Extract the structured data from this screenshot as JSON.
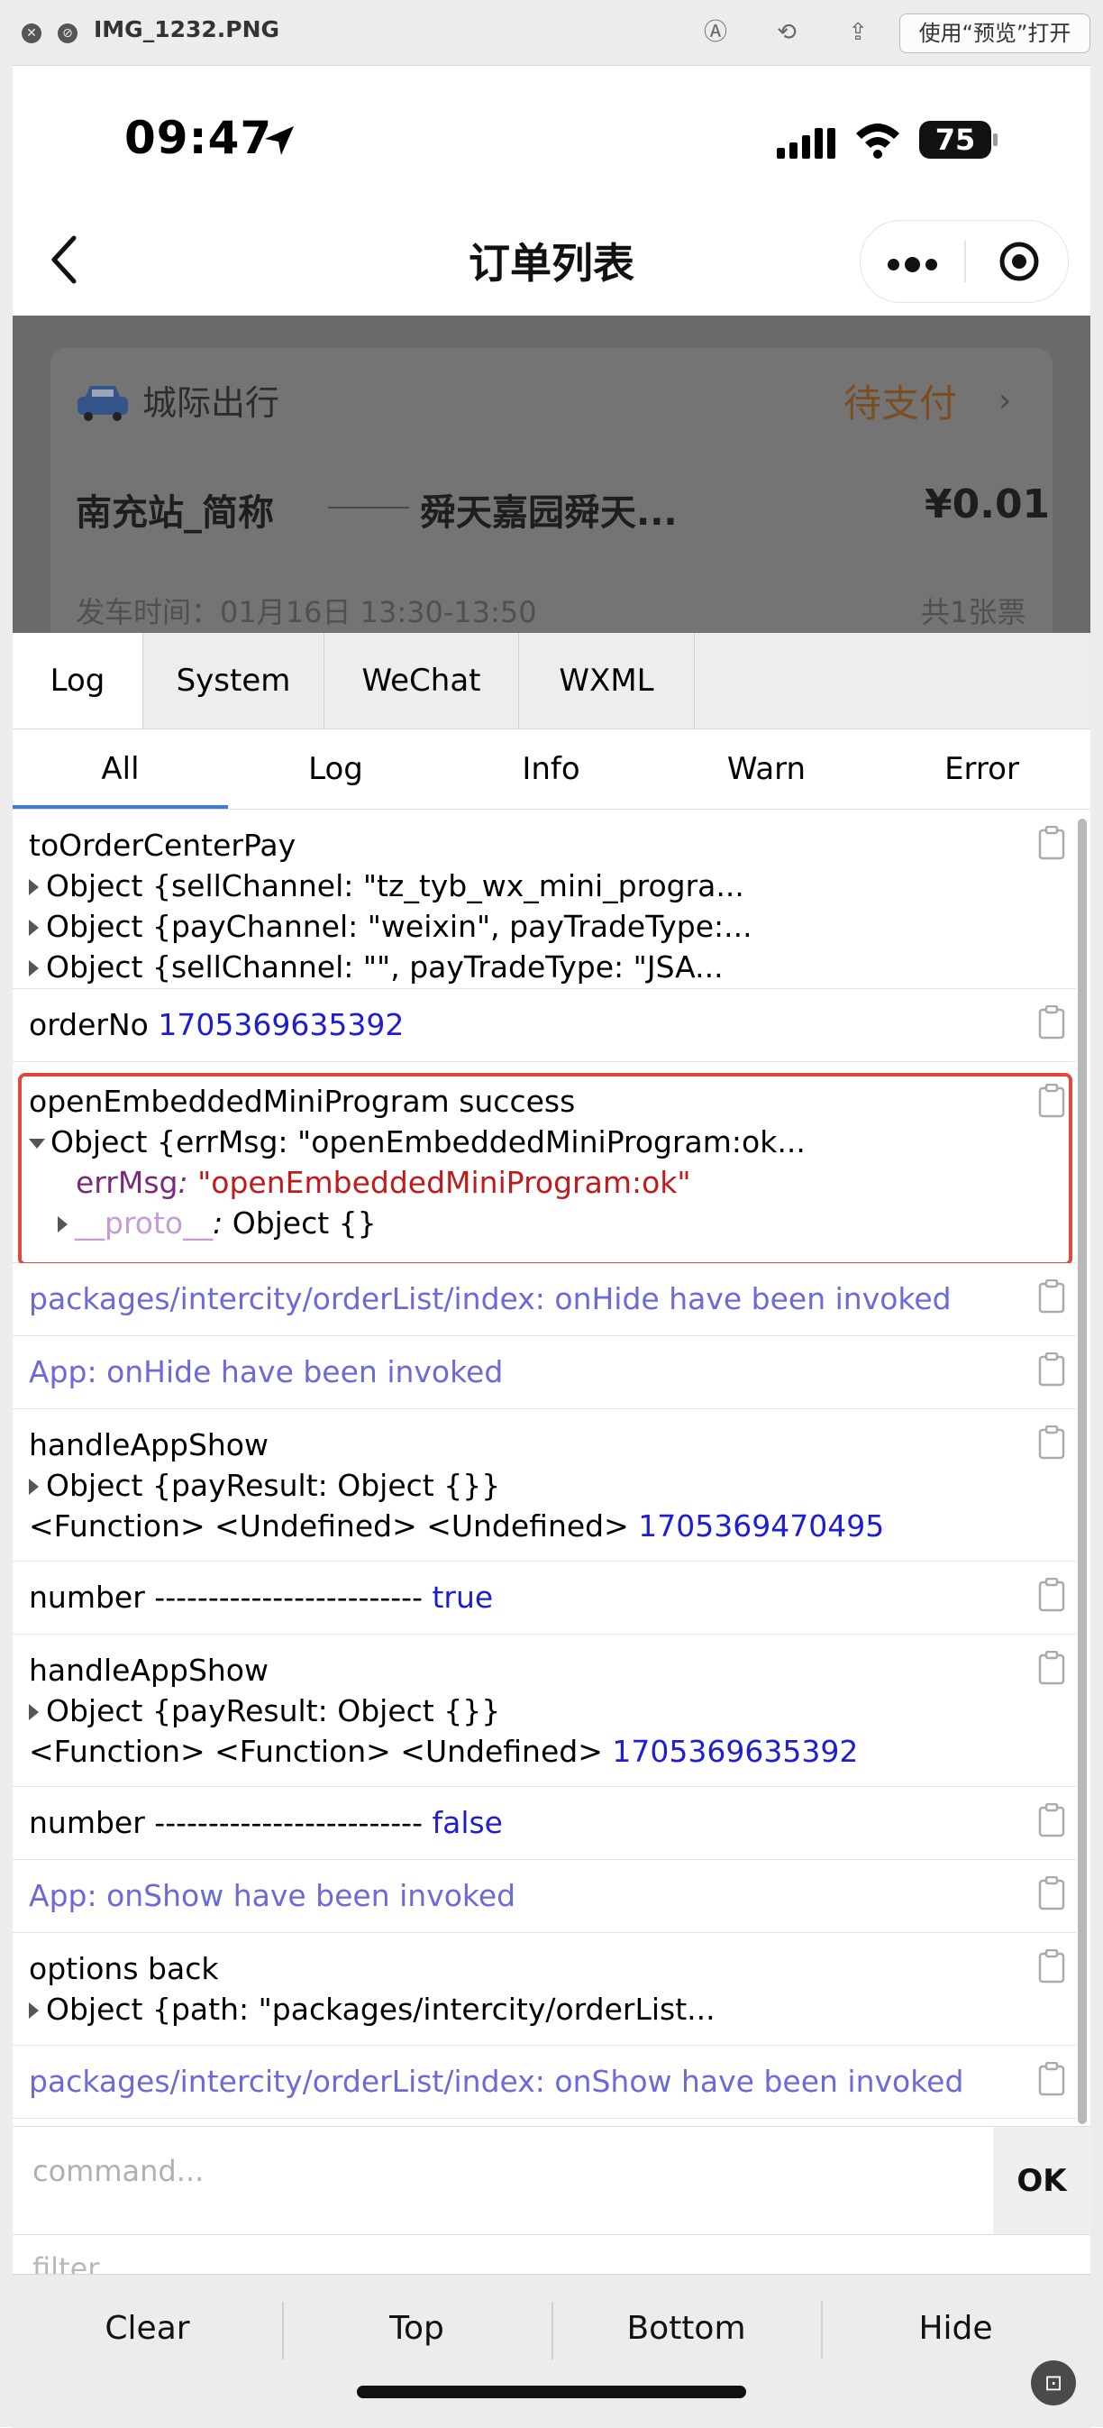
{
  "mac_window": {
    "filename": "IMG_1232.PNG",
    "open_with": "使用“预览”打开"
  },
  "status_bar": {
    "time": "09:47",
    "battery": "75"
  },
  "nav": {
    "title": "订单列表"
  },
  "order_card": {
    "category": "城际出行",
    "status": "待支付",
    "from": "南充站_简称",
    "to": "舜天嘉园舜天...",
    "price": "¥0.01",
    "depart_time": "发车时间：01月16日 13:30-13:50",
    "ticket_count": "共1张票"
  },
  "vconsole": {
    "tabs": [
      "Log",
      "System",
      "WeChat",
      "WXML"
    ],
    "subtabs": [
      "All",
      "Log",
      "Info",
      "Warn",
      "Error"
    ],
    "entries": {
      "e1_title": "toOrderCenterPay",
      "e1_obj1": "Object {sellChannel: \"tz_tyb_wx_mini_progra...",
      "e1_obj2": "Object {payChannel: \"weixin\", payTradeType:...",
      "e1_obj3": "Object {sellChannel: \"\", payTradeType: \"JSA...",
      "e2_label": "orderNo",
      "e2_value": "1705369635392",
      "e3_title": "openEmbeddedMiniProgram success",
      "e3_obj": "Object {errMsg: \"openEmbeddedMiniProgram:ok...",
      "e3_key": "errMsg",
      "e3_val": "\"openEmbeddedMiniProgram:ok\"",
      "e3_proto": "__proto__",
      "e3_proto_val": "Object {}",
      "e4_text": "packages/intercity/orderList/index: onHide have been invoked",
      "e5_text": "App: onHide have been invoked",
      "e6_title": "handleAppShow",
      "e6_obj": "Object {payResult: Object {}}",
      "e6_types": "<Function> <Undefined> <Undefined>",
      "e6_num": "1705369470495",
      "e7_label": "number -------------------------",
      "e7_value": "true",
      "e8_title": "handleAppShow",
      "e8_obj": "Object {payResult: Object {}}",
      "e8_types": "<Function> <Function> <Undefined>",
      "e8_num": "1705369635392",
      "e9_label": "number -------------------------",
      "e9_value": "false",
      "e10_text": "App: onShow have been invoked",
      "e11_title": "options back",
      "e11_obj": "Object {path: \"packages/intercity/orderList...",
      "e12_text": "packages/intercity/orderList/index: onShow have been invoked"
    },
    "command_placeholder": "command...",
    "ok_label": "OK",
    "filter_placeholder": "filter...",
    "footer": [
      "Clear",
      "Top",
      "Bottom",
      "Hide"
    ]
  },
  "colors": {
    "highlight_border": "#e04a3c",
    "active_subtab": "#3b7be0",
    "value_blue": "#1d1dd6",
    "system_text": "#6a6ad8"
  }
}
